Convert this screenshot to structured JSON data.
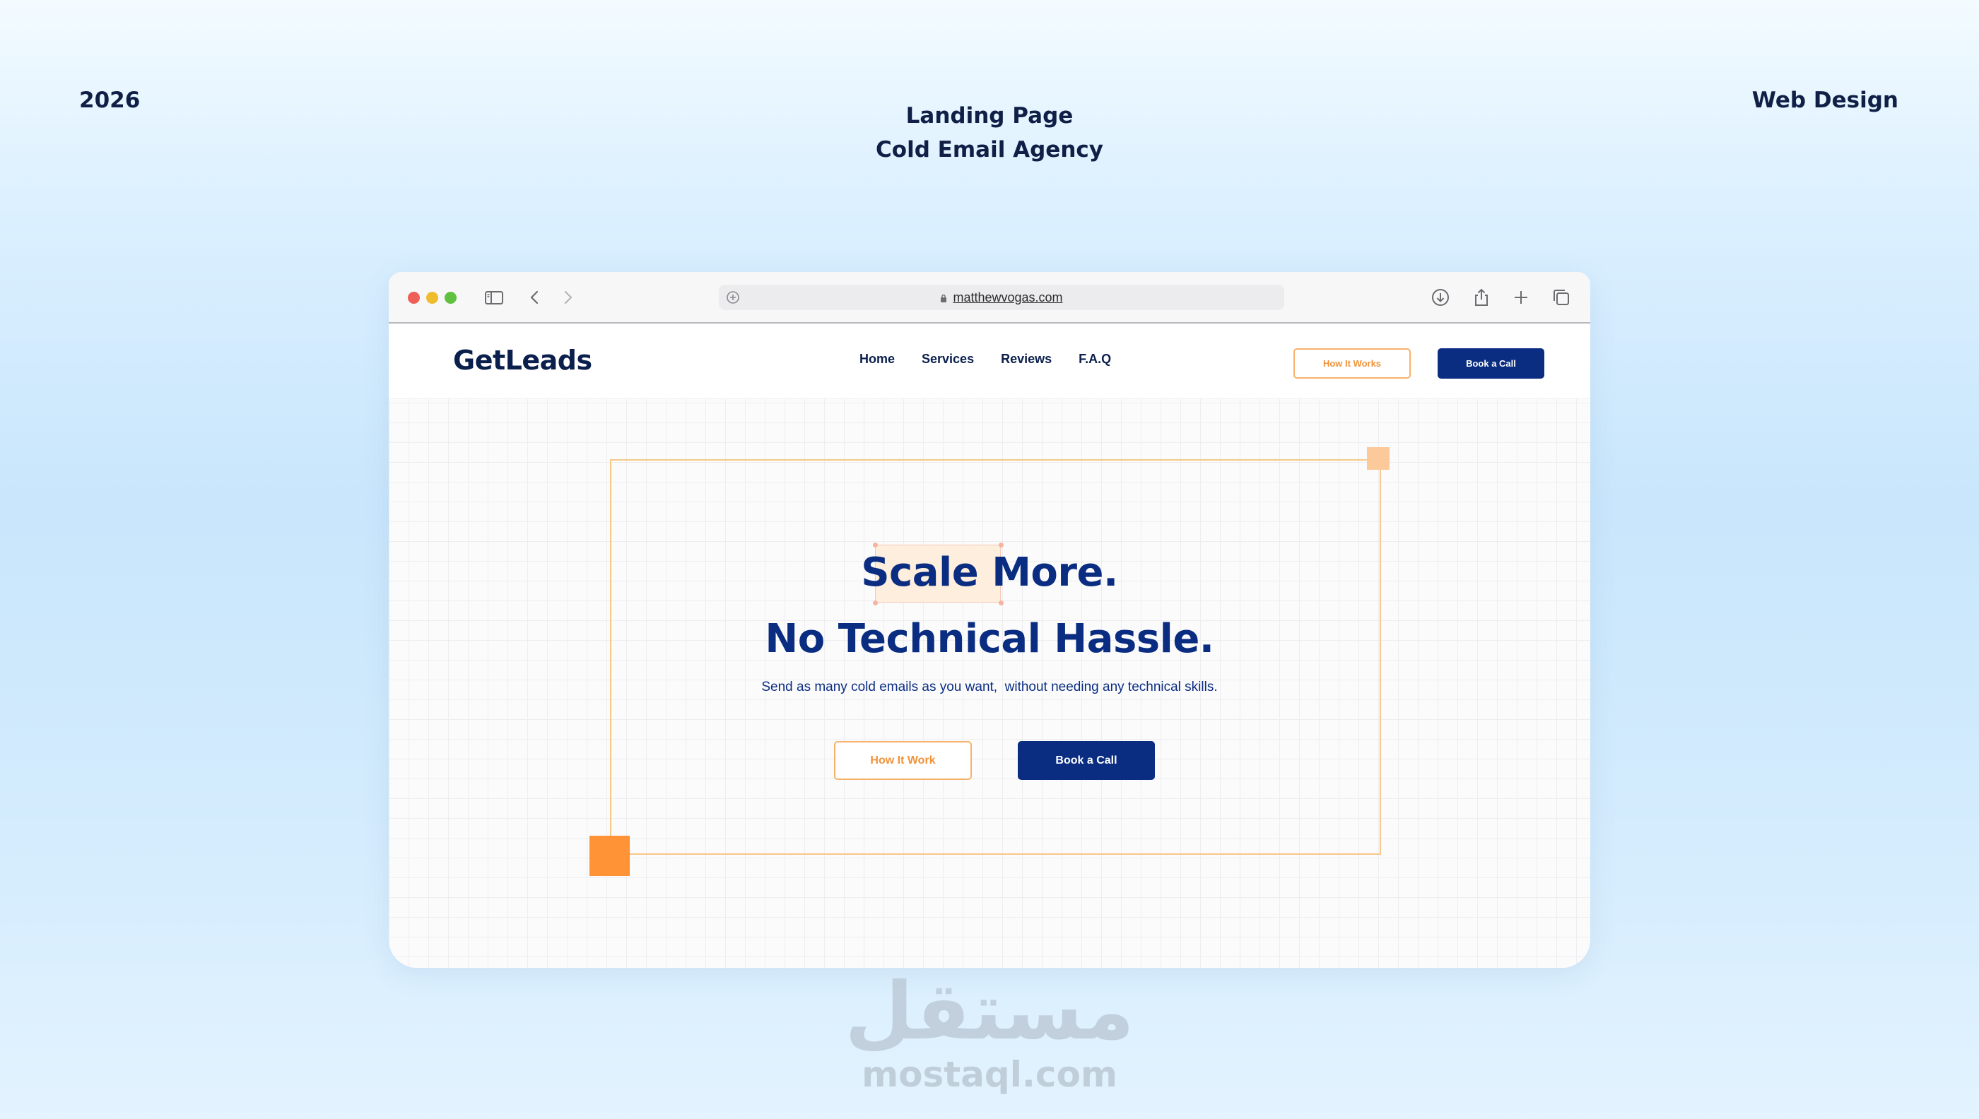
{
  "meta": {
    "year": "2026",
    "title_line1": "Landing Page",
    "title_line2": "Cold Email Agency",
    "category": "Web Design"
  },
  "browser": {
    "url": "matthewvogas.com",
    "toolbar_icons": [
      "sidebar-icon",
      "back-chevron-icon",
      "forward-chevron-icon",
      "download-icon",
      "share-icon",
      "new-tab-plus-icon",
      "tabs-overview-icon"
    ]
  },
  "site": {
    "logo": "GetLeads",
    "nav": [
      {
        "label": "Home"
      },
      {
        "label": "Services"
      },
      {
        "label": "Reviews"
      },
      {
        "label": "F.A.Q"
      }
    ],
    "nav_how_label": "How It Works",
    "nav_book_label": "Book a Call",
    "hero": {
      "highlight_word": "Scale",
      "line1_rest": " More.",
      "line2": "No Technical Hassle.",
      "subtitle": "Send as many cold emails as you want,  without needing any technical skills.",
      "how_label": "How It Work",
      "book_label": "Book a Call"
    }
  },
  "colors": {
    "navy": "#0a2d82",
    "orange": "#ff9335",
    "orange_light": "#fcc99a",
    "frame": "#f6c88a"
  },
  "watermark": {
    "arabic": "مستقل",
    "latin": "mostaql.com"
  }
}
